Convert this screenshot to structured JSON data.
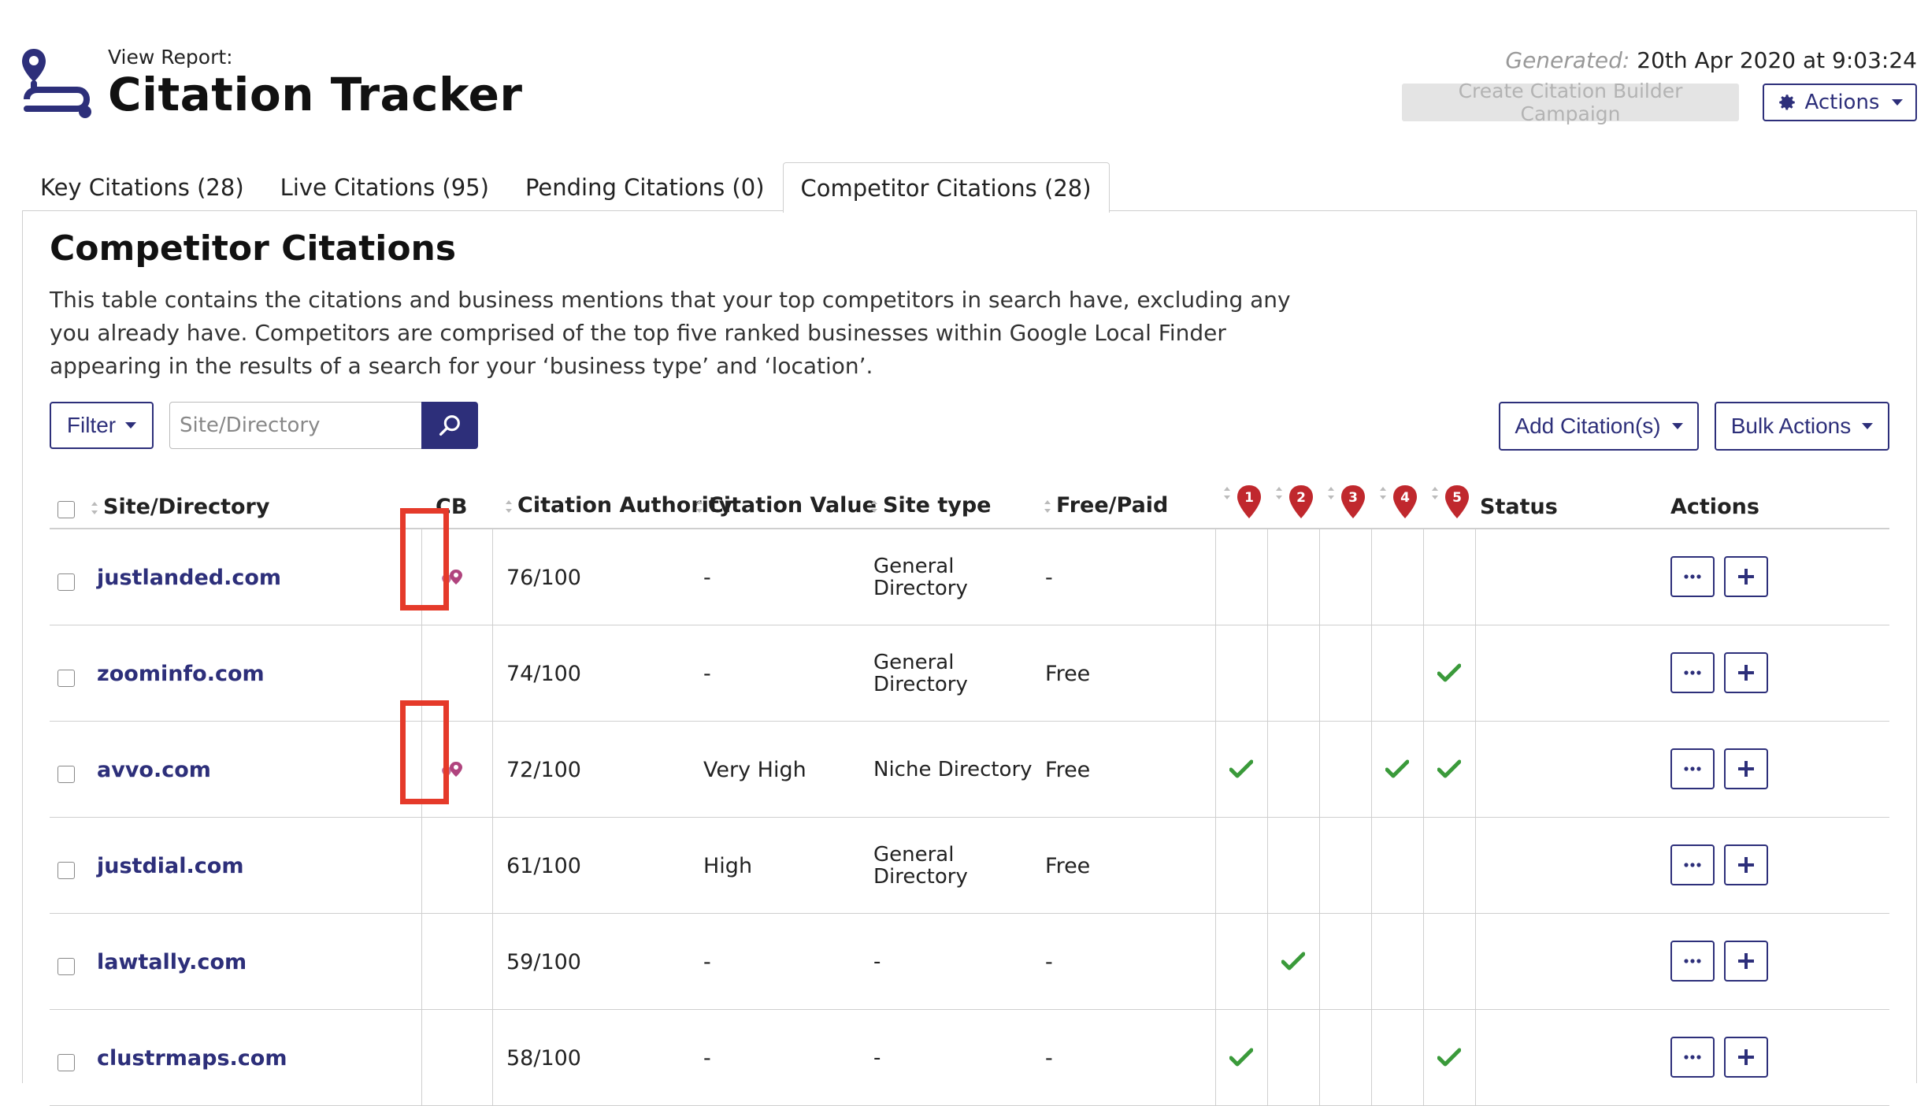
{
  "header": {
    "view_report_label": "View Report:",
    "title": "Citation Tracker",
    "generated_label": "Generated:",
    "generated_value": "20th Apr 2020 at 9:03:24",
    "create_campaign_label": "Create Citation Builder Campaign",
    "actions_label": "Actions"
  },
  "tabs": [
    {
      "label": "Key Citations (28)",
      "active": false
    },
    {
      "label": "Live Citations (95)",
      "active": false
    },
    {
      "label": "Pending Citations (0)",
      "active": false
    },
    {
      "label": "Competitor Citations (28)",
      "active": true
    }
  ],
  "section": {
    "title": "Competitor Citations",
    "description": "This table contains the citations and business mentions that your top competitors in search have, excluding any you already have. Competitors are comprised of the top five ranked businesses within Google Local Finder appearing in the results of a search for your ‘business type’ and ‘location’."
  },
  "toolbar": {
    "filter_label": "Filter",
    "search_placeholder": "Site/Directory",
    "add_citation_label": "Add Citation(s)",
    "bulk_actions_label": "Bulk Actions"
  },
  "columns": {
    "site": "Site/Directory",
    "cb": "CB",
    "authority": "Citation Authority",
    "value": "Citation Value",
    "site_type": "Site type",
    "free_paid": "Free/Paid",
    "competitors": [
      "1",
      "2",
      "3",
      "4",
      "5"
    ],
    "status": "Status",
    "actions": "Actions"
  },
  "rows": [
    {
      "site": "justlanded.com",
      "cb": true,
      "authority": "76/100",
      "value": "-",
      "site_type_1": "General",
      "site_type_2": "Directory",
      "free_paid": "-",
      "competitors": [
        false,
        false,
        false,
        false,
        false
      ]
    },
    {
      "site": "zoominfo.com",
      "cb": false,
      "authority": "74/100",
      "value": "-",
      "site_type_1": "General",
      "site_type_2": "Directory",
      "free_paid": "Free",
      "competitors": [
        false,
        false,
        false,
        false,
        true
      ]
    },
    {
      "site": "avvo.com",
      "cb": true,
      "authority": "72/100",
      "value": "Very High",
      "site_type_1": "Niche Directory",
      "site_type_2": "",
      "free_paid": "Free",
      "competitors": [
        true,
        false,
        false,
        true,
        true
      ]
    },
    {
      "site": "justdial.com",
      "cb": false,
      "authority": "61/100",
      "value": "High",
      "site_type_1": "General",
      "site_type_2": "Directory",
      "free_paid": "Free",
      "competitors": [
        false,
        false,
        false,
        false,
        false
      ]
    },
    {
      "site": "lawtally.com",
      "cb": false,
      "authority": "59/100",
      "value": "-",
      "site_type_1": "-",
      "site_type_2": "",
      "free_paid": "-",
      "competitors": [
        false,
        true,
        false,
        false,
        false
      ]
    },
    {
      "site": "clustrmaps.com",
      "cb": false,
      "authority": "58/100",
      "value": "-",
      "site_type_1": "-",
      "site_type_2": "",
      "free_paid": "-",
      "competitors": [
        true,
        false,
        false,
        false,
        true
      ]
    }
  ],
  "colors": {
    "brand": "#2d2f7a",
    "pin": "#c0282d",
    "check": "#3a9a3a",
    "cb_icon": "#b0447e",
    "highlight": "#e53a2a"
  },
  "icons": {
    "logo": "route-pin-icon",
    "search": "search-icon",
    "gear": "gear-icon",
    "cb": "location-pins-icon",
    "more": "ellipsis-icon",
    "add": "plus-icon",
    "check": "checkmark-icon"
  }
}
